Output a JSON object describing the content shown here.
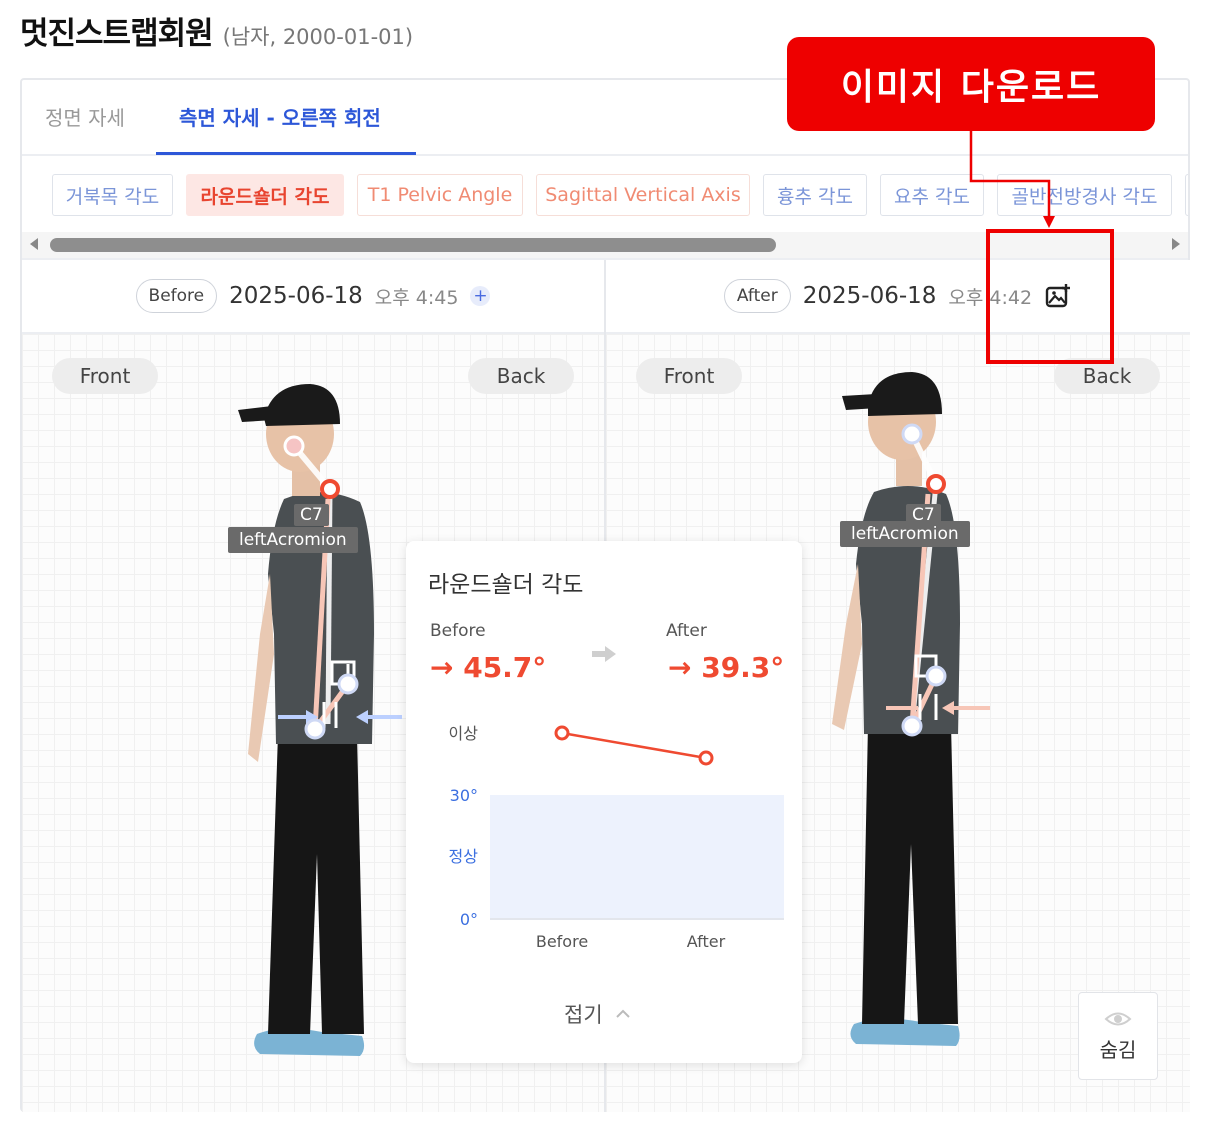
{
  "member": {
    "name": "멋진스트랩회원",
    "meta": "(남자, 2000-01-01)"
  },
  "tabs": [
    {
      "label": "정면 자세",
      "active": false
    },
    {
      "label": "측면 자세 - 오른쪽 회전",
      "active": true
    }
  ],
  "chips": [
    {
      "label": "거북목 각도"
    },
    {
      "label": "라운드숄더 각도",
      "active": true
    },
    {
      "label": "T1 Pelvic Angle"
    },
    {
      "label": "Sagittal Vertical Axis"
    },
    {
      "label": "흉추 각도"
    },
    {
      "label": "요추 각도"
    },
    {
      "label": "골반전방경사 각도"
    }
  ],
  "panels": [
    {
      "badge": "Before",
      "date": "2025-06-18",
      "time": "오후 4:45",
      "action": "+",
      "front": "Front",
      "back": "Back",
      "labels": {
        "c7": "C7",
        "acromion": "leftAcromion"
      }
    },
    {
      "badge": "After",
      "date": "2025-06-18",
      "time": "오후 4:42",
      "front": "Front",
      "back": "Back",
      "labels": {
        "c7": "C7",
        "acromion": "leftAcromion"
      }
    }
  ],
  "popup": {
    "title": "라운드숄더 각도",
    "before_label": "Before",
    "after_label": "After",
    "before_value": "→ 45.7°",
    "after_value": "→ 39.3°",
    "fold_label": "접기"
  },
  "chart_data": {
    "type": "line",
    "categories": [
      "Before",
      "After"
    ],
    "values": [
      45.7,
      39.3
    ],
    "y_tick_labels": [
      "이상",
      "30°",
      "정상",
      "0°"
    ],
    "normal_band": [
      0,
      30
    ],
    "colors": {
      "line": "#ef4a31",
      "band": "#edf2fd",
      "ticks": "#3b6fe0"
    }
  },
  "hide_button": {
    "label": "숨김"
  },
  "callout": {
    "text": "이미지 다운로드"
  },
  "colors": {
    "accent": "#2d57d8",
    "active_chip_bg": "#fde7e4",
    "active_chip_text": "#e8442f",
    "callout": "#ee0000"
  }
}
